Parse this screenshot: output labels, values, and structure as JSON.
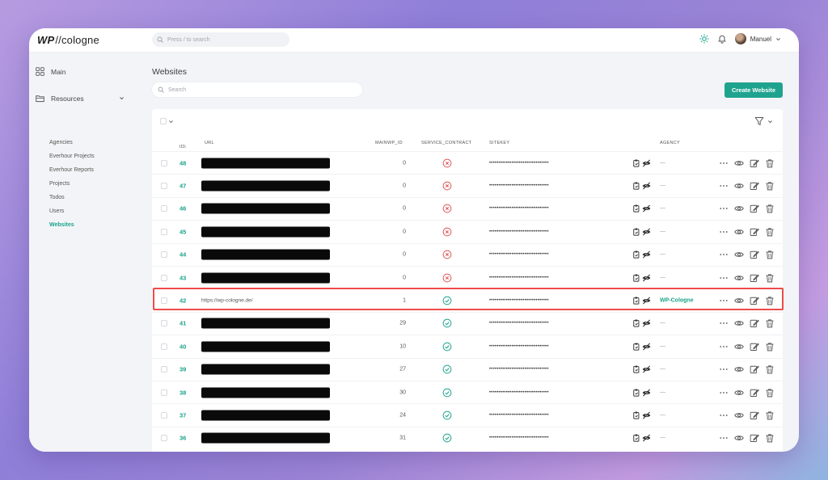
{
  "app": {
    "logo_mark": "WP",
    "logo_text": "//cologne"
  },
  "topbar": {
    "search_placeholder": "Press / to search",
    "user_name": "Manuel"
  },
  "sidebar": {
    "main_label": "Main",
    "resources_label": "Resources",
    "items": [
      {
        "label": "Agencies",
        "active": false
      },
      {
        "label": "Everhour Projects",
        "active": false
      },
      {
        "label": "Everhour Reports",
        "active": false
      },
      {
        "label": "Projects",
        "active": false
      },
      {
        "label": "Todos",
        "active": false
      },
      {
        "label": "Users",
        "active": false
      },
      {
        "label": "Websites",
        "active": true
      }
    ]
  },
  "page": {
    "title": "Websites",
    "search_placeholder": "Search",
    "create_button": "Create Website"
  },
  "table": {
    "headers": {
      "id": "ID",
      "url": "URL",
      "mainwp_id": "MAINWP_ID",
      "service_contract": "SERVICE_CONTRACT",
      "sitekey": "SITEKEY",
      "agency": "AGENCY"
    },
    "rows": [
      {
        "id": "48",
        "url": "",
        "redacted": true,
        "mainwp_id": "0",
        "service_contract": false,
        "sitekey": "••••••••••••••••••••••••••••••••",
        "agency": "—"
      },
      {
        "id": "47",
        "url": "",
        "redacted": true,
        "mainwp_id": "0",
        "service_contract": false,
        "sitekey": "••••••••••••••••••••••••••••••••",
        "agency": "—"
      },
      {
        "id": "46",
        "url": "",
        "redacted": true,
        "mainwp_id": "0",
        "service_contract": false,
        "sitekey": "••••••••••••••••••••••••••••••••",
        "agency": "—"
      },
      {
        "id": "45",
        "url": "",
        "redacted": true,
        "mainwp_id": "0",
        "service_contract": false,
        "sitekey": "••••••••••••••••••••••••••••••••",
        "agency": "—"
      },
      {
        "id": "44",
        "url": "",
        "redacted": true,
        "mainwp_id": "0",
        "service_contract": false,
        "sitekey": "••••••••••••••••••••••••••••••••",
        "agency": "—"
      },
      {
        "id": "43",
        "url": "",
        "redacted": true,
        "mainwp_id": "0",
        "service_contract": false,
        "sitekey": "••••••••••••••••••••••••••••••••",
        "agency": "—"
      },
      {
        "id": "42",
        "url": "https://wp-cologne.de/",
        "redacted": false,
        "mainwp_id": "1",
        "service_contract": true,
        "sitekey": "••••••••••••••••••••••••••••••••",
        "agency": "WP-Cologne",
        "agency_link": true
      },
      {
        "id": "41",
        "url": "",
        "redacted": true,
        "mainwp_id": "29",
        "service_contract": true,
        "sitekey": "••••••••••••••••••••••••••••••••",
        "agency": "—"
      },
      {
        "id": "40",
        "url": "",
        "redacted": true,
        "mainwp_id": "10",
        "service_contract": true,
        "sitekey": "••••••••••••••••••••••••••••••••",
        "agency": "—"
      },
      {
        "id": "39",
        "url": "",
        "redacted": true,
        "mainwp_id": "27",
        "service_contract": true,
        "sitekey": "••••••••••••••••••••••••••••••••",
        "agency": "—"
      },
      {
        "id": "38",
        "url": "",
        "redacted": true,
        "mainwp_id": "30",
        "service_contract": true,
        "sitekey": "••••••••••••••••••••••••••••••••",
        "agency": "—"
      },
      {
        "id": "37",
        "url": "",
        "redacted": true,
        "mainwp_id": "24",
        "service_contract": true,
        "sitekey": "••••••••••••••••••••••••••••••••",
        "agency": "—"
      },
      {
        "id": "36",
        "url": "",
        "redacted": true,
        "mainwp_id": "31",
        "service_contract": true,
        "sitekey": "••••••••••••••••••••••••••••••••",
        "agency": "—"
      }
    ],
    "highlighted_row_id": "42"
  },
  "colors": {
    "accent": "#1fa38f",
    "highlight": "#ee4b4b",
    "error": "#e05a5a",
    "success": "#1fa38f"
  },
  "icons": {
    "search": "search-icon",
    "sun": "sun-icon",
    "bell": "bell-icon",
    "grid": "grid-icon",
    "folder": "folder-icon",
    "filter": "filter-icon",
    "copy": "copy-icon",
    "eye_off": "eye-off-icon",
    "more": "more-icon",
    "eye": "eye-icon",
    "edit": "edit-icon",
    "trash": "trash-icon"
  }
}
